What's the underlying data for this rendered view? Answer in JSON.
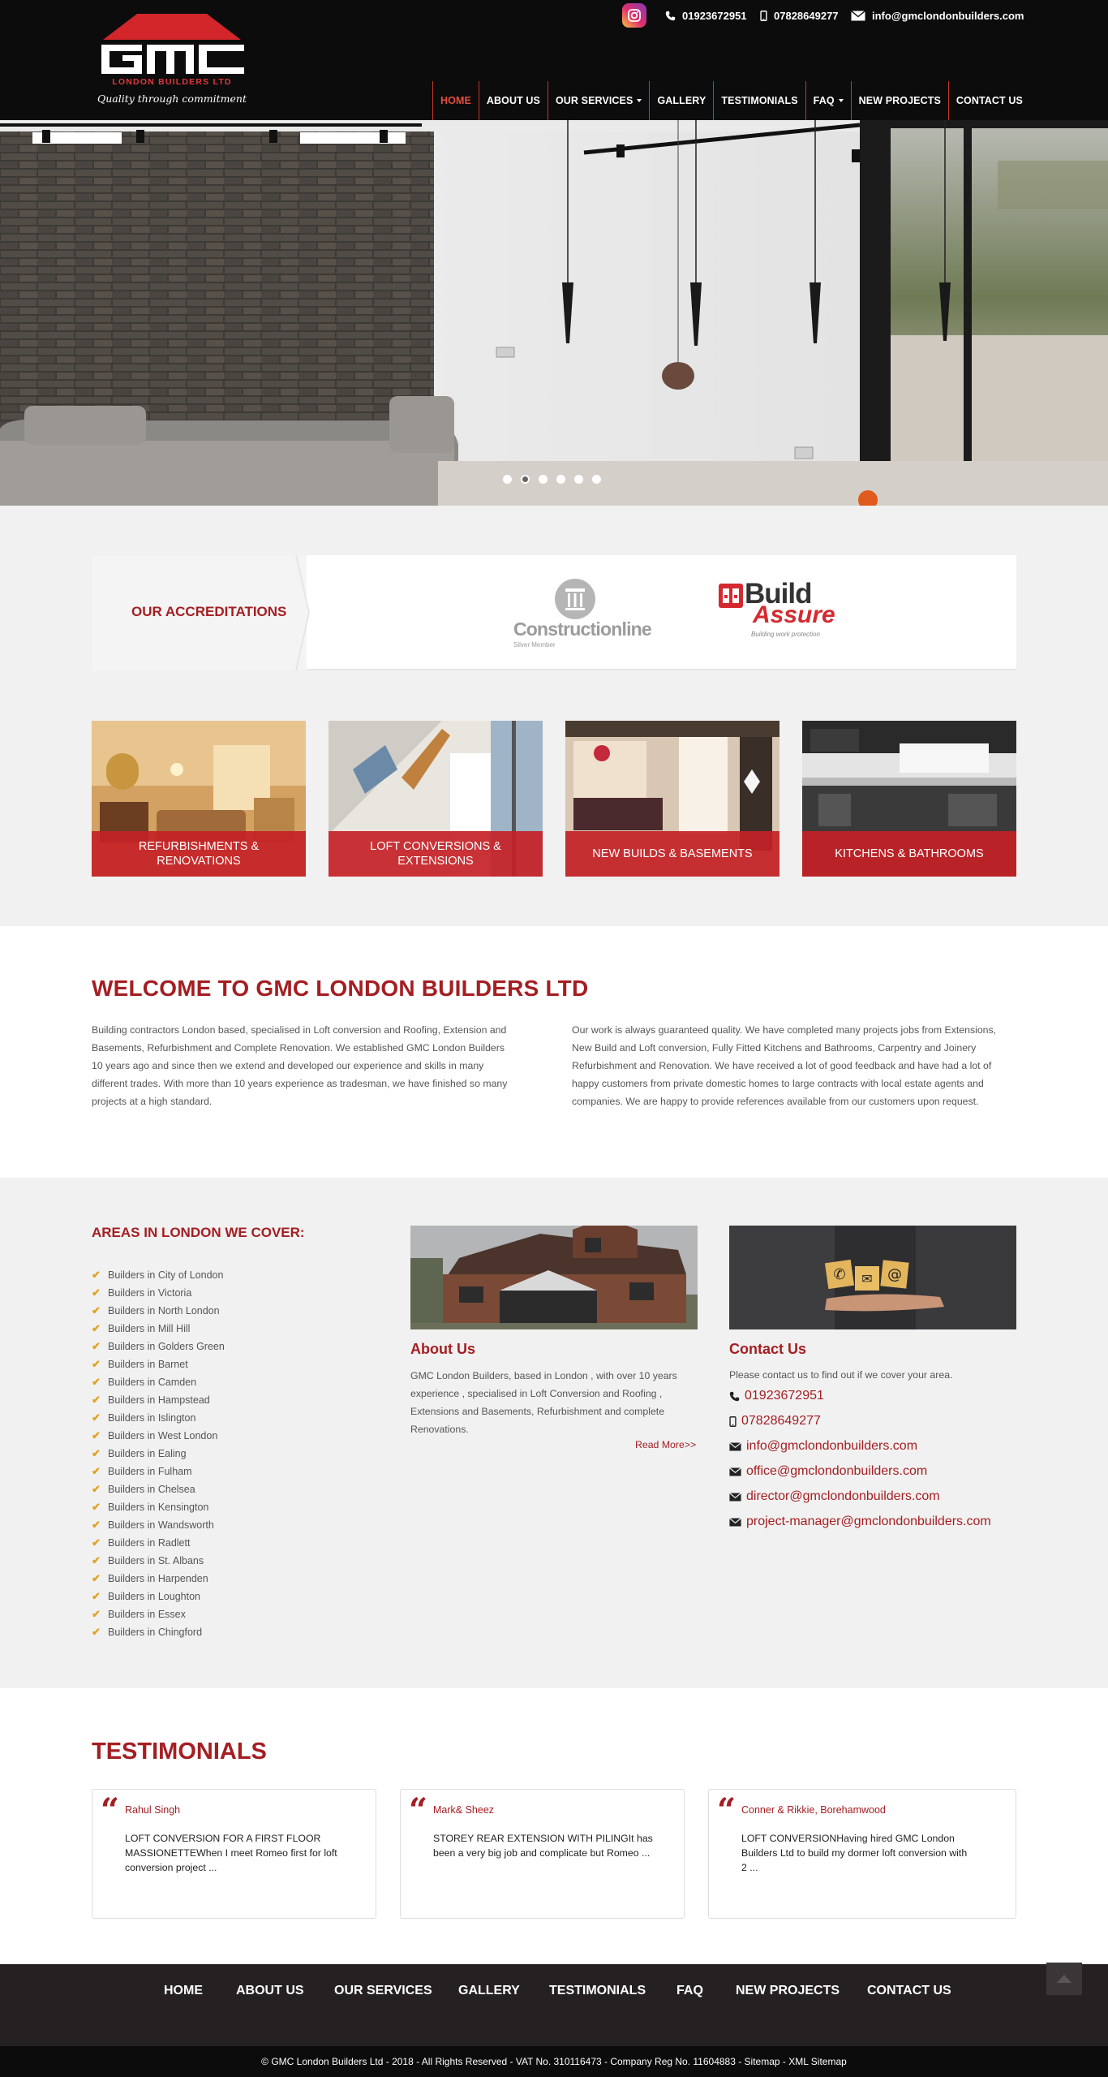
{
  "header": {
    "phone1": "01923672951",
    "phone2": "07828649277",
    "email": "info@gmclondonbuilders.com",
    "logo": {
      "brand": "GMC",
      "sub": "LONDON BUILDERS LTD",
      "tagline": "Quality through commitment"
    },
    "nav": [
      {
        "label": "HOME",
        "active": true
      },
      {
        "label": "ABOUT US"
      },
      {
        "label": "OUR SERVICES",
        "dropdown": true
      },
      {
        "label": "GALLERY"
      },
      {
        "label": "TESTIMONIALS"
      },
      {
        "label": "FAQ",
        "dropdown": true
      },
      {
        "label": "NEW PROJECTS"
      },
      {
        "label": "CONTACT US"
      }
    ]
  },
  "hero": {
    "slide_count": 6,
    "active_slide": 2
  },
  "accreditations": {
    "label": "OUR ACCREDITATIONS",
    "logos": [
      {
        "name": "Constructionline",
        "sub": "Silver Member"
      },
      {
        "name": "Build Assure",
        "line1": "Build",
        "line2": "Assure",
        "sub": "Building work protection"
      }
    ]
  },
  "services": [
    {
      "label": "REFURBISHMENTS & RENOVATIONS"
    },
    {
      "label": "LOFT CONVERSIONS & EXTENSIONS"
    },
    {
      "label": "NEW BUILDS & BASEMENTS"
    },
    {
      "label": "KITCHENS & BATHROOMS"
    }
  ],
  "welcome": {
    "title": "WELCOME TO GMC LONDON BUILDERS LTD",
    "para1": "Building contractors London based, specialised in Loft conversion and Roofing, Extension and Basements, Refurbishment and Complete Renovation. We established GMC London Builders 10 years ago and since then we extend and developed our experience and skills in many different trades. With more than 10 years experience as tradesman, we have finished so many projects at a high standard.",
    "para2": "Our work is always guaranteed quality. We have completed many projects jobs from Extensions, New Build and Loft conversion, Fully Fitted Kitchens and Bathrooms, Carpentry and Joinery Refurbishment and Renovation. We have received a lot of good feedback and have had a lot of happy customers from private domestic homes to large contracts with local estate agents and companies. We are happy to provide references available from our customers upon request."
  },
  "areas": {
    "title": "AREAS IN LONDON WE COVER:",
    "items": [
      "Builders in City of London",
      "Builders in Victoria",
      "Builders in North London",
      "Builders in Mill Hill",
      "Builders in Golders Green",
      "Builders in Barnet",
      "Builders in Camden",
      "Builders in Hampstead",
      "Builders in Islington",
      "Builders in West London",
      "Builders in Ealing",
      "Builders in Fulham",
      "Builders in Chelsea",
      "Builders in Kensington",
      "Builders in Wandsworth",
      "Builders in Radlett",
      "Builders in St. Albans",
      "Builders in Harpenden",
      "Builders in Loughton",
      "Builders in Essex",
      "Builders in Chingford"
    ]
  },
  "about": {
    "title": "About Us",
    "text": "GMC London Builders, based in London , with over 10 years experience , specialised in Loft Conversion and Roofing , Extensions and Basements, Refurbishment and complete Renovations.",
    "read_more": "Read More>>"
  },
  "contact": {
    "title": "Contact Us",
    "intro": "Please contact us to find out if we cover your area.",
    "phone1": "01923672951",
    "phone2": "07828649277",
    "emails": [
      "info@gmclondonbuilders.com",
      "office@gmclondonbuilders.com",
      "director@gmclondonbuilders.com",
      "project-manager@gmclondonbuilders.com"
    ]
  },
  "testimonials": {
    "title": "TESTIMONIALS",
    "items": [
      {
        "name": "Rahul Singh",
        "text": "LOFT CONVERSION FOR A FIRST FLOOR MASSIONETTEWhen I meet Romeo first for loft conversion project ..."
      },
      {
        "name": "Mark& Sheez",
        "text": "STOREY REAR EXTENSION WITH PILINGIt has been a very big job and complicate but Romeo ..."
      },
      {
        "name": "Conner & Rikkie, Borehamwood",
        "text": "LOFT CONVERSIONHaving hired GMC London Builders Ltd to build my dormer loft conversion with 2 ..."
      }
    ]
  },
  "footer": {
    "nav": [
      "HOME",
      "ABOUT US",
      "OUR SERVICES",
      "GALLERY",
      "TESTIMONIALS",
      "FAQ",
      "NEW PROJECTS",
      "CONTACT US"
    ],
    "copyright": "© GMC London Builders Ltd - 2018 - All Rights Reserved - VAT No. 310116473 - Company Reg No. 11604883 - Sitemap - XML Sitemap"
  },
  "colors": {
    "brand_red": "#a41e22",
    "accent_red": "#c42226",
    "header_bg": "#0c0c0c",
    "footer_bg": "#252122"
  }
}
